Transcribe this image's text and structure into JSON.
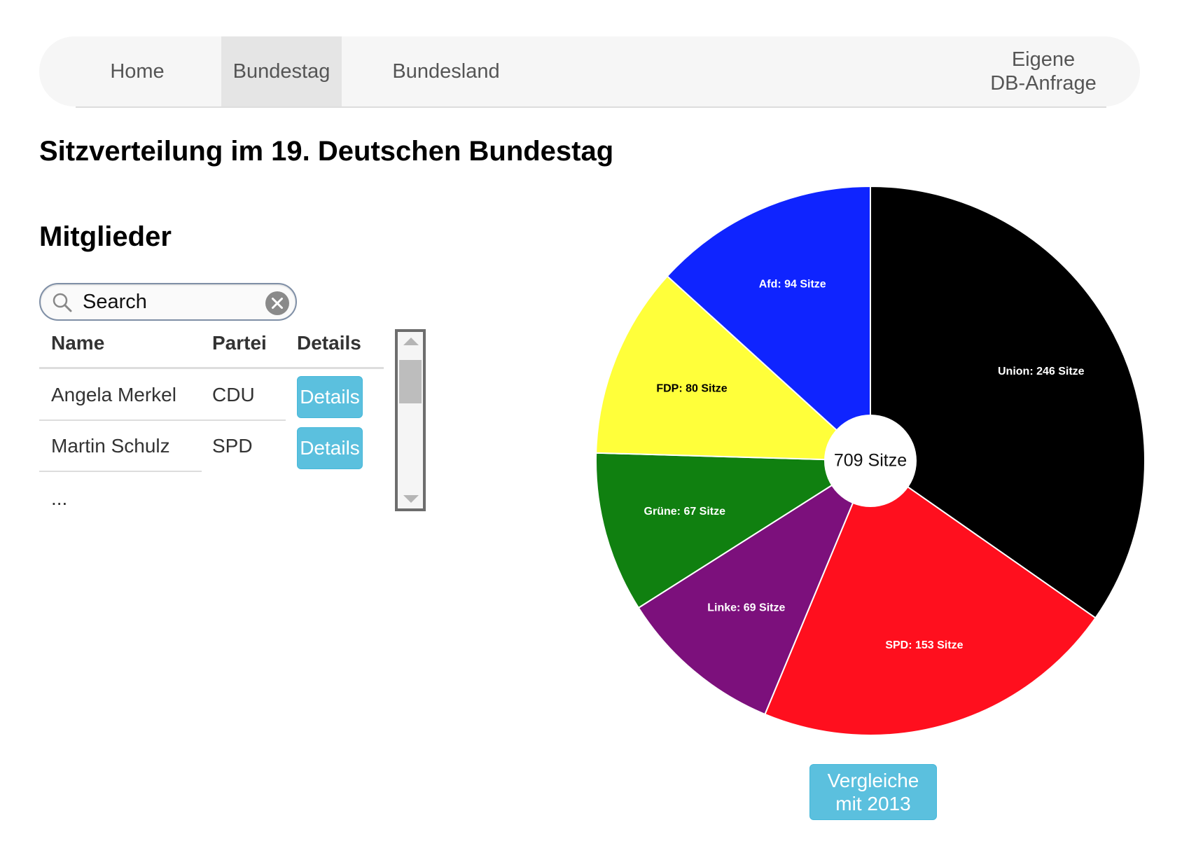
{
  "nav": {
    "home": "Home",
    "bundestag": "Bundestag",
    "bundesland": "Bundesland",
    "db_line1": "Eigene",
    "db_line2": "DB-Anfrage",
    "active": "Bundestag"
  },
  "page_title": "Sitzverteilung im 19. Deutschen Bundestag",
  "members": {
    "title": "Mitglieder",
    "search": {
      "placeholder": "Search",
      "icon": "search-icon",
      "clear_icon": "clear-icon"
    },
    "columns": [
      "Name",
      "Partei",
      "Details"
    ],
    "rows": [
      {
        "name": "Angela Merkel",
        "party": "CDU",
        "details_label": "Details"
      },
      {
        "name": "Martin Schulz",
        "party": "SPD",
        "details_label": "Details"
      }
    ],
    "more": "..."
  },
  "chart_data": {
    "type": "pie",
    "total_label": "709 Sitze",
    "slices": [
      {
        "label": "Union: 246 Sitze",
        "value": 246,
        "color": "#000000",
        "text_color": "#ffffff"
      },
      {
        "label": "SPD: 153 Sitze",
        "value": 153,
        "color": "#ff0f1e",
        "text_color": "#ffffff"
      },
      {
        "label": "Linke: 69 Sitze",
        "value": 69,
        "color": "#7c107c",
        "text_color": "#ffffff"
      },
      {
        "label": "Grüne: 67 Sitze",
        "value": 67,
        "color": "#108010",
        "text_color": "#ffffff"
      },
      {
        "label": "FDP: 80 Sitze",
        "value": 80,
        "color": "#ffff3a",
        "text_color": "#000000"
      },
      {
        "label": "Afd: 94 Sitze",
        "value": 94,
        "color": "#0f24ff",
        "text_color": "#ffffff"
      }
    ]
  },
  "compare_button": {
    "line1": "Vergleiche",
    "line2": "mit 2013"
  }
}
